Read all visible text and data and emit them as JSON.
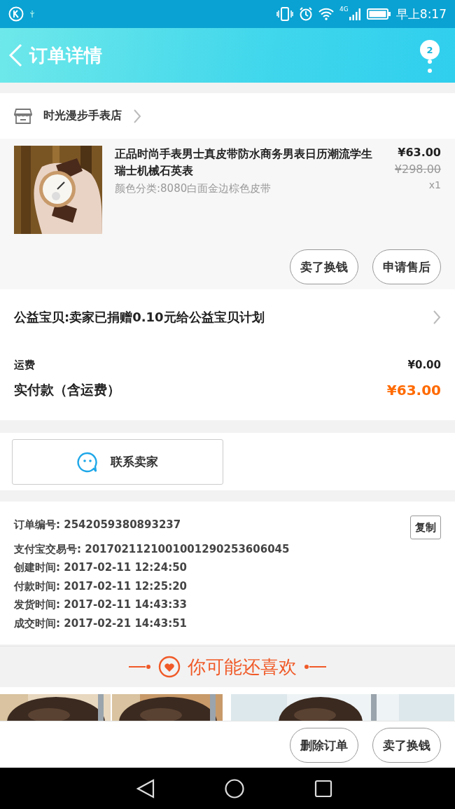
{
  "status_bar": {
    "network": "4G",
    "time": "早上8:17"
  },
  "header": {
    "title": "订单详情",
    "badge": "2"
  },
  "shop": {
    "name": "时光漫步手表店"
  },
  "item": {
    "title": "正品时尚手表男士真皮带防水商务男表日历潮流学生瑞士机械石英表",
    "variant": "颜色分类:8080白面金边棕色皮带",
    "price": "¥63.00",
    "original_price": "¥298.00",
    "quantity": "x1",
    "buttons": [
      "卖了换钱",
      "申请售后"
    ]
  },
  "charity": {
    "text": "公益宝贝:卖家已捐赠0.10元给公益宝贝计划"
  },
  "summary": [
    {
      "label": "运费",
      "value": "¥0.00",
      "kind": "plain"
    },
    {
      "label": "实付款（含运费）",
      "value": "¥63.00",
      "kind": "total"
    }
  ],
  "contact": {
    "label": "联系卖家"
  },
  "order_info": {
    "lines": [
      "订单编号: 2542059380893237",
      "支付宝交易号: 2017021121001001290253606045",
      "创建时间: 2017-02-11 12:24:50",
      "付款时间: 2017-02-11 12:25:20",
      "发货时间: 2017-02-11 14:43:33",
      "成交时间: 2017-02-21 14:43:51"
    ],
    "copy_button": "复制"
  },
  "recommend": {
    "title": "你可能还喜欢"
  },
  "bottom_buttons": [
    "删除订单",
    "卖了换钱"
  ]
}
